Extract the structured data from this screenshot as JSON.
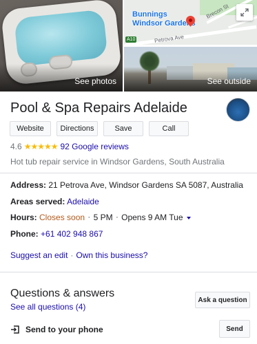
{
  "photos": {
    "main_label": "See photos",
    "outside_label": "See outside",
    "map": {
      "place_name_line1": "Bunnings",
      "place_name_line2": "Windsor Gardens",
      "street_1": "Brecon St",
      "street_2": "Petrova Ave",
      "road_shield": "A10",
      "expand_icon": "expand-icon"
    }
  },
  "business": {
    "name": "Pool & Spa Repairs Adelaide",
    "actions": {
      "website": "Website",
      "directions": "Directions",
      "save": "Save",
      "call": "Call"
    },
    "rating": "4.6",
    "stars": "★★★★★",
    "reviews_link": "92 Google reviews",
    "category": "Hot tub repair service in Windsor Gardens, South Australia"
  },
  "details": {
    "address_label": "Address:",
    "address_value": "21 Petrova Ave, Windsor Gardens SA 5087, Australia",
    "areas_label": "Areas served:",
    "areas_value": "Adelaide",
    "hours_label": "Hours:",
    "hours_status": "Closes soon",
    "hours_dot": "⋅",
    "hours_close": "5 PM",
    "hours_open": "Opens 9 AM Tue",
    "phone_label": "Phone:",
    "phone_value": "+61 402 948 867"
  },
  "edit": {
    "suggest": "Suggest an edit",
    "sep": "·",
    "own": "Own this business?"
  },
  "qa": {
    "title": "Questions & answers",
    "see_all": "See all questions (4)",
    "ask_button": "Ask a question"
  },
  "send": {
    "label": "Send to your phone",
    "button": "Send"
  },
  "colors": {
    "link": "#1a0dab",
    "closes_soon": "#b3591a",
    "star": "#fbbc04"
  }
}
